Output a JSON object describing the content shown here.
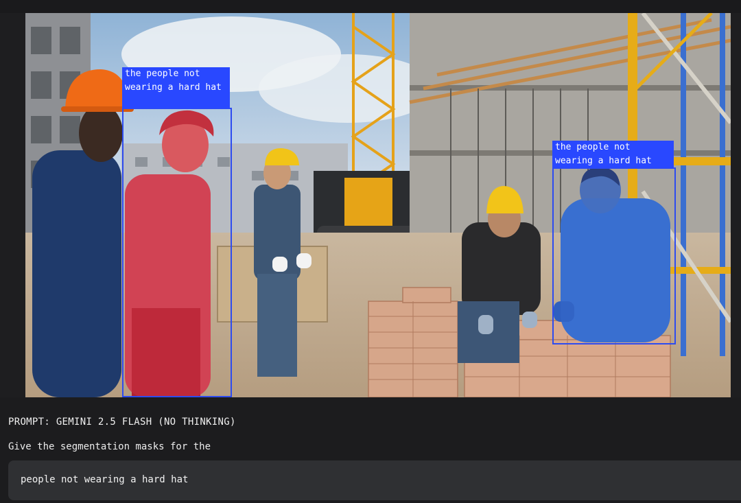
{
  "annotations": [
    {
      "label": "the people not wearing a hard hat"
    },
    {
      "label": "the people not wearing a hard hat"
    }
  ],
  "prompt": {
    "title": "PROMPT: GEMINI 2.5 FLASH (NO THINKING)",
    "instruction": "Give the segmentation masks for the",
    "query": "people not wearing a hard hat"
  },
  "colors": {
    "box_border": "#2d4bf0",
    "label_background": "#2948ff",
    "mask_red": "#d9364a",
    "mask_blue": "#3a6fd0",
    "page_background": "#1c1c1e",
    "input_background": "#2f3033"
  },
  "icons": [
    "orange-hard-hat",
    "yellow-hard-hat"
  ]
}
